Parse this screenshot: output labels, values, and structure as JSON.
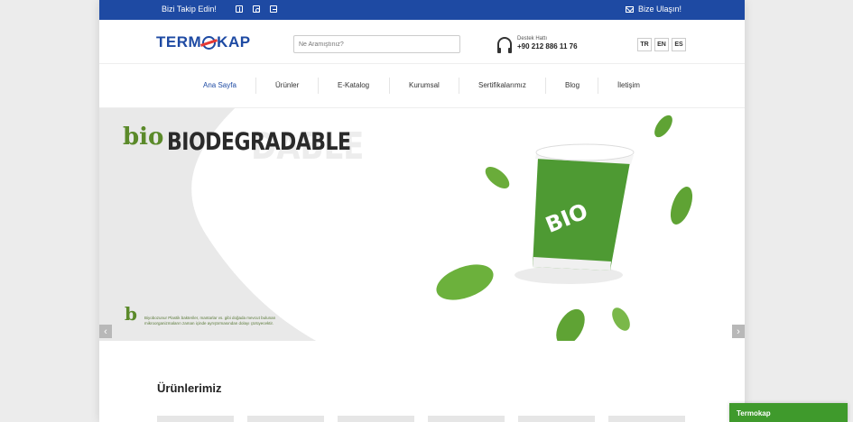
{
  "topbar": {
    "follow_label": "Bizi Takip Edin!",
    "social_icons": [
      "facebook-icon",
      "instagram-icon",
      "twitter-icon"
    ],
    "contact_label": "Bize Ulaşın!"
  },
  "header": {
    "logo_text_left": "TERM",
    "logo_text_right": "KAP",
    "search_placeholder": "Ne Aramıştınız?",
    "support_label": "Destek Hattı",
    "support_phone": "+90 212 886 11 76",
    "languages": [
      "TR",
      "EN",
      "ES"
    ]
  },
  "nav": {
    "items": [
      "Ana Sayfa",
      "Ürünler",
      "E-Katalog",
      "Kurumsal",
      "Sertifikalarımız",
      "Blog",
      "İletişim"
    ],
    "active": "Ana Sayfa"
  },
  "hero": {
    "mark_text": "bio",
    "title": "BIODEGRADABLE",
    "title_shadow": "DABLE",
    "cup_text": "BIO",
    "footer_mark": "b",
    "footer_text": "Biyobozunur Plastik bakteriler, mantarlar vs. gibi doğada mevcut bulunan mikroorganizmaların zaman içinde ayrıştırmasından dolayı çürüyecektir."
  },
  "products": {
    "title": "Ürünlerimiz"
  },
  "chat": {
    "label": "Termokap"
  },
  "colors": {
    "brand_blue": "#1e4aa3",
    "brand_red": "#e53935",
    "bio_green": "#5b8a2a",
    "chat_green": "#3f9a2c"
  }
}
